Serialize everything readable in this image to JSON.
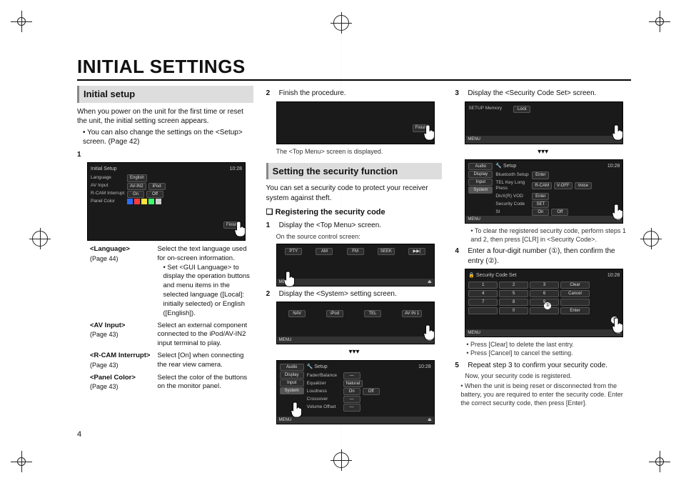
{
  "page": {
    "title": "INITIAL SETTINGS",
    "number": "4"
  },
  "col1": {
    "h_initial_setup": "Initial setup",
    "intro1": "When you power on the unit for the first time or reset the unit, the initial setting screen appears.",
    "intro_bullet": "You can also change the settings on the <Setup> screen. (Page 42)",
    "step1_num": "1",
    "shot1": {
      "title": "Initial Setup",
      "clock": "10:28",
      "rows": [
        {
          "label": "Language",
          "opts": [
            "English"
          ]
        },
        {
          "label": "AV Input",
          "opts": [
            "AV-IN2",
            "iPod"
          ]
        },
        {
          "label": "R-CAM Interrupt",
          "opts": [
            "On",
            "Off"
          ]
        },
        {
          "label": "Panel Color",
          "swatches": [
            "#2b6cff",
            "#ff3b3b",
            "#ffe23b",
            "#3bff6c",
            "#cccccc"
          ]
        }
      ],
      "finish": "Finish"
    },
    "defs": [
      {
        "term": "<Language>",
        "pg": "(Page 44)",
        "body": "Select the text language used for on-screen information.",
        "sub": "Set <GUI Language> to display the operation buttons and menu items in the selected language ([Local]: initially selected) or English ([English])."
      },
      {
        "term": "<AV Input>",
        "pg": "(Page 43)",
        "body": "Select an external component connected to the iPod/AV-IN2 input terminal to play."
      },
      {
        "term": "<R-CAM Interrupt>",
        "pg": "(Page 43)",
        "body": "Select [On] when connecting the rear view camera."
      },
      {
        "term": "<Panel Color>",
        "pg": "(Page 43)",
        "body": "Select the color of the buttons on the monitor panel."
      }
    ]
  },
  "col2": {
    "step2_num": "2",
    "step2_text": "Finish the procedure.",
    "shot_finish": {
      "finish": "Finish"
    },
    "after_finish": "The <Top Menu> screen is displayed.",
    "h_security": "Setting the security function",
    "sec_intro": "You can set a security code to protect your receiver system against theft.",
    "h_registering": "❏ Registering the security code",
    "sec_step1_num": "1",
    "sec_step1": "Display the <Top Menu> screen.",
    "sec_step1_sub": "On the source control screen:",
    "shot_source": {
      "bands": [
        "PTY",
        "AM",
        "FM",
        "SEEK",
        "▶▶|",
        "◀"
      ],
      "menubar_l": "MENU",
      "menubar_r": "⏏"
    },
    "sec_step2_num": "2",
    "sec_step2": "Display the <System> setting screen.",
    "shot_topmenu": {
      "tiles": [
        "NAV",
        "iPod",
        "TEL",
        "AV IN 1"
      ],
      "menubar_l": "MENU",
      "menubar_r": "⏏"
    },
    "shot_setup": {
      "title": "Setup",
      "clock": "10:28",
      "side": [
        "Audio",
        "Display",
        "Input",
        "System"
      ],
      "rows": [
        {
          "label": "Fader/Balance",
          "opts": [
            "—"
          ]
        },
        {
          "label": "Equalizer",
          "opts": [
            "Natural"
          ]
        },
        {
          "label": "Loudness",
          "opts": [
            "On",
            "Off"
          ]
        },
        {
          "label": "Crossover",
          "opts": [
            "—"
          ]
        },
        {
          "label": "Volume Offset",
          "opts": [
            "—"
          ]
        }
      ],
      "menubar_l": "MENU",
      "menubar_r": "⏏"
    }
  },
  "col3": {
    "step3_num": "3",
    "step3_text": "Display the <Security Code Set> screen.",
    "shot_memory": {
      "title": "",
      "clock": "",
      "row": {
        "label": "SETUP Memory",
        "opts": [
          "Lock"
        ]
      },
      "menubar_l": "MENU",
      "menubar_r": "⏏"
    },
    "shot_system": {
      "title": "Setup",
      "clock": "10:28",
      "side": [
        "Audio",
        "Display",
        "Input",
        "System"
      ],
      "rows": [
        {
          "label": "Bluetooth Setup",
          "opts": [
            "Enter"
          ]
        },
        {
          "label": "TEL Key Long Press",
          "opts": [
            "R-CAM",
            "V-OFF",
            "Voice"
          ]
        },
        {
          "label": "DivX(R) VOD",
          "opts": [
            "Enter"
          ]
        },
        {
          "label": "Security Code",
          "opts": [
            "SET"
          ]
        },
        {
          "label": "SI",
          "opts": [
            "On",
            "Off"
          ]
        }
      ],
      "menubar_l": "MENU",
      "menubar_r": "⏏"
    },
    "note_clear": "To clear the registered security code, perform steps 1 and 2, then press [CLR] in <Security Code>.",
    "step4_num": "4",
    "step4_text": "Enter a four-digit number (①), then confirm the entry (②).",
    "shot_keypad": {
      "title": "Security Code Set",
      "clock": "10:28",
      "keys": [
        [
          "1",
          "2",
          "3",
          "Clear"
        ],
        [
          "4",
          "5",
          "6",
          "Cancel"
        ],
        [
          "7",
          "8",
          "9",
          ""
        ],
        [
          "",
          "0",
          "",
          "Enter"
        ]
      ],
      "menubar_l": "MENU",
      "menubar_r": "⏏",
      "circ1": "①",
      "circ2": "②"
    },
    "press_clear": "Press [Clear] to delete the last entry.",
    "press_cancel": "Press [Cancel] to cancel the setting.",
    "step5_num": "5",
    "step5_text": "Repeat step 3 to confirm your security code.",
    "step5_sub": "Now, your security code is registered.",
    "final_bullet": "When the unit is being reset or disconnected from the battery, you are required to enter the security code. Enter the correct security code, then press [Enter]."
  }
}
